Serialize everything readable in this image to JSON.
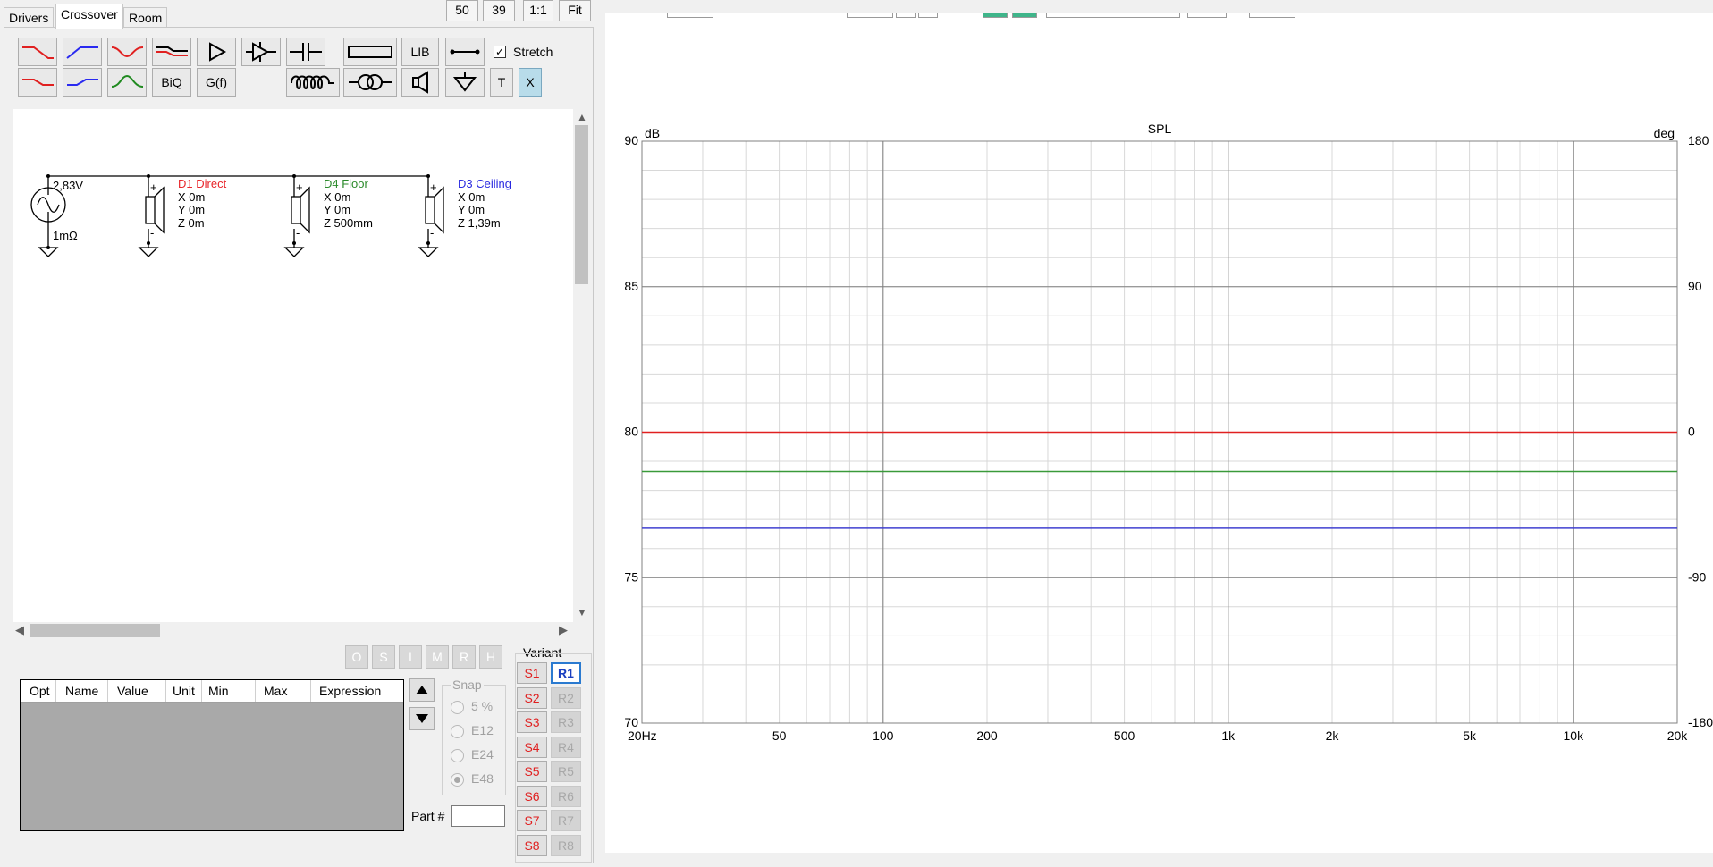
{
  "tabs": [
    "Drivers",
    "Crossover",
    "Room"
  ],
  "zoom_buttons": [
    "50",
    "39",
    "1:1",
    "Fit"
  ],
  "toolbar": {
    "lib_label": "LIB",
    "biq_label": "BiQ",
    "gf_label": "G(f)",
    "t_label": "T",
    "x_label": "X",
    "stretch_label": "Stretch",
    "stretch_checked": true
  },
  "schematic": {
    "source_voltage": "2,83V",
    "source_resistance": "1mΩ",
    "drivers": [
      {
        "name": "D1 Direct",
        "x": "X 0m",
        "y": "Y 0m",
        "z": "Z 0m",
        "color": "#e8252a"
      },
      {
        "name": "D4 Floor",
        "x": "X 0m",
        "y": "Y 0m",
        "z": "Z 500mm",
        "color": "#2a8a2a"
      },
      {
        "name": "D3 Ceiling",
        "x": "X 0m",
        "y": "Y 0m",
        "z": "Z 1,39m",
        "color": "#2a2ae0"
      }
    ]
  },
  "opt_buttons": [
    "O",
    "S",
    "I",
    "M",
    "R",
    "H"
  ],
  "param_table": {
    "columns": [
      "Opt",
      "Name",
      "Value",
      "Unit",
      "Min",
      "Max",
      "Expression"
    ]
  },
  "snap": {
    "label": "Snap",
    "options": [
      "5 %",
      "E12",
      "E24",
      "E48"
    ],
    "selected": "E48"
  },
  "part_label": "Part #",
  "part_value": "",
  "variant": {
    "label": "Variant",
    "s_buttons": [
      "S1",
      "S2",
      "S3",
      "S4",
      "S5",
      "S6",
      "S7",
      "S8"
    ],
    "r_buttons": [
      "R1",
      "R2",
      "R3",
      "R4",
      "R5",
      "R6",
      "R7",
      "R8"
    ],
    "active_r": "R1"
  },
  "chart_data": {
    "type": "line",
    "title": "SPL",
    "ylabel": "dB",
    "y2label": "deg",
    "xscale": "log",
    "xlim": [
      20,
      20000
    ],
    "ylim": [
      70,
      90
    ],
    "y2lim": [
      -180,
      180
    ],
    "x_ticks": [
      {
        "v": 20,
        "l": "20Hz"
      },
      {
        "v": 50,
        "l": "50"
      },
      {
        "v": 100,
        "l": "100"
      },
      {
        "v": 200,
        "l": "200"
      },
      {
        "v": 500,
        "l": "500"
      },
      {
        "v": 1000,
        "l": "1k"
      },
      {
        "v": 2000,
        "l": "2k"
      },
      {
        "v": 5000,
        "l": "5k"
      },
      {
        "v": 10000,
        "l": "10k"
      },
      {
        "v": 20000,
        "l": "20k"
      }
    ],
    "y_ticks": [
      90,
      85,
      80,
      75,
      70
    ],
    "y2_ticks": [
      "180",
      "90",
      "0",
      "-90",
      "-180"
    ],
    "grid": true,
    "series": [
      {
        "color": "#e02020",
        "x": [
          20,
          20000
        ],
        "y": [
          80.0,
          80.0
        ]
      },
      {
        "color": "#3a9a3a",
        "x": [
          20,
          20000
        ],
        "y": [
          78.65,
          78.65
        ]
      },
      {
        "color": "#4040d0",
        "x": [
          20,
          20000
        ],
        "y": [
          76.7,
          76.7
        ]
      }
    ]
  }
}
